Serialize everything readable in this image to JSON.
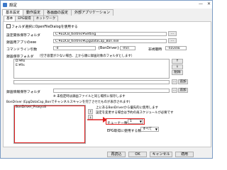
{
  "window": {
    "title": "設定",
    "minimize": "—",
    "close": "✕"
  },
  "tabs": [
    "基本設定",
    "動作設定",
    "各画面の設定",
    "外部アプリケーション"
  ],
  "subtabs": [
    "基本",
    "EPG取得",
    "ネットワーク"
  ],
  "folder_dialog_checkbox": "フォルダ選択にOpenFileDialogを使用する",
  "settings_folder": {
    "label": "設定関係保存フォルダ",
    "value": "C:¥EDCB_tkntrec¥Setting",
    "button": "..."
  },
  "recording_app": {
    "label": "録画用アプリのexe",
    "value": "C:¥EDCB_tkntrec¥EpgDataCap_Bon.exe",
    "button": "..."
  },
  "cmdline": {
    "label": "コマンドライン引数",
    "value": "-d",
    "bondriver": "{BonDriver}",
    "min_label": "-min",
    "viewoff_label": "非視聴時",
    "viewoff_value": "-noview"
  },
  "rec_folder": {
    "label": "録画保存フォルダ",
    "note": "（空き容量が少ない場合、上から順に録画対象のフォルダとします）",
    "items": [
      "D:¥Rs",
      "E:¥Rs"
    ],
    "buttons": [
      "↑",
      "↓",
      "削除",
      "..."
    ],
    "add_button": "追加"
  },
  "rec_info_folder": {
    "label": "録画情報保存フォルダ",
    "button": "...",
    "add_button": "追加",
    "note": "※ 未指定時は録画ファイルと同じ場所に保存します"
  },
  "bondriver_section": {
    "label": "BonDriver (EpgDataCap_Bonでチャンネルスキャンを完了させたものが表示されます)",
    "items": [
      "BonDriver_Proxy.dll"
    ],
    "option1": "上にあるBonDriverから優先的に使用します",
    "option2": "設定を変更する場合は予約の再スケジュールが必要です",
    "tuner_label": "チューナー数",
    "tuner_value": "1",
    "epg_label": "EPG取得に使用する数",
    "epg_value": "すべて"
  },
  "footer": {
    "apply": "再読込",
    "ok": "OK",
    "cancel": "キャンセル",
    "reapply": "適用"
  }
}
